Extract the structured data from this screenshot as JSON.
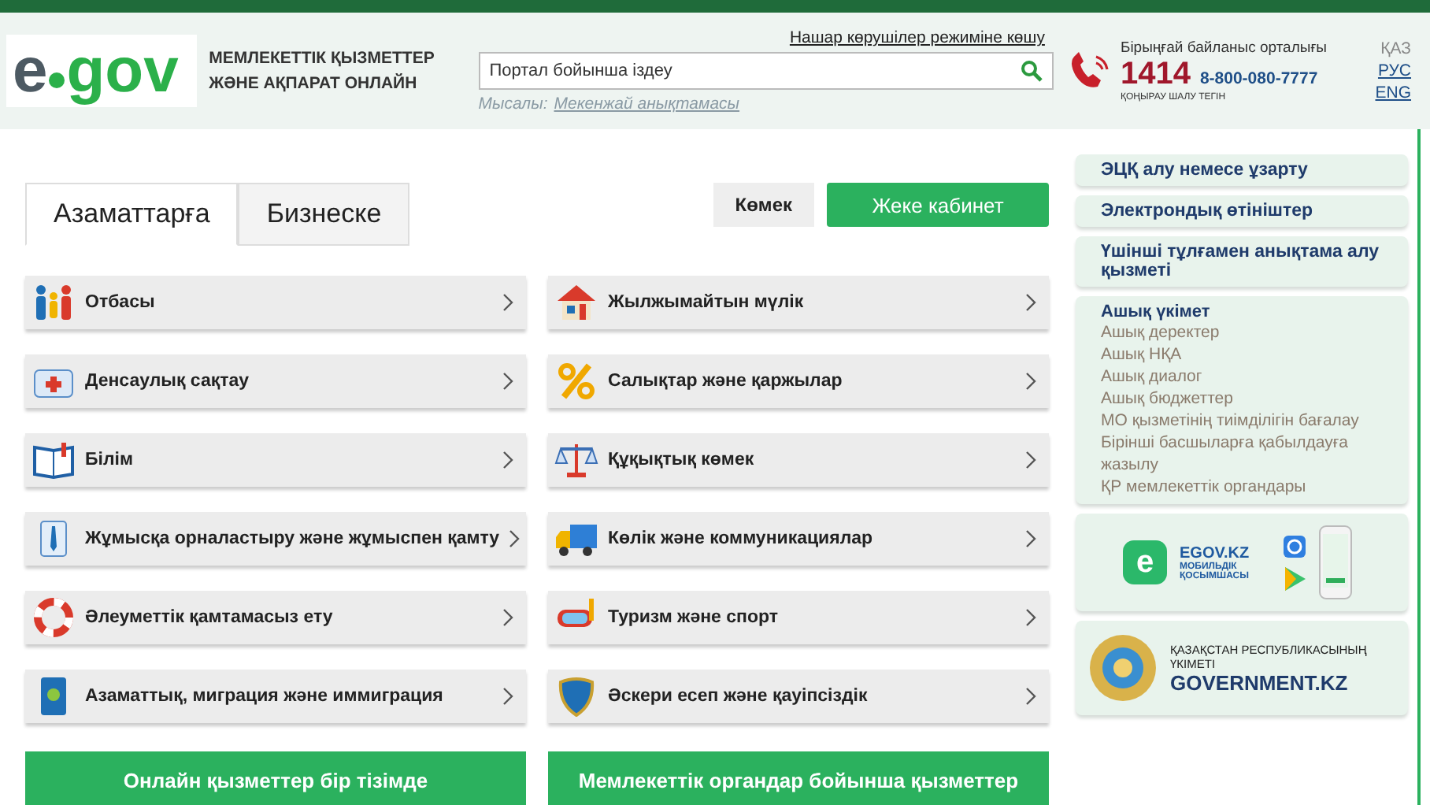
{
  "header": {
    "logo": {
      "prefix": "e",
      "word": "gov"
    },
    "tagline": [
      "МЕМЛЕКЕТТІК ҚЫЗМЕТТЕР",
      "ЖӘНЕ АҚПАРАТ ОНЛАЙН"
    ],
    "accessibility_link": "Нашар көрушілер режиміне көшу",
    "search": {
      "placeholder": "Портал бойынша іздеу"
    },
    "example": {
      "label": "Мысалы:",
      "link": "Мекенжай анықтамасы"
    },
    "contact": {
      "title": "Бірыңғай байланыс орталығы",
      "short_number": "1414",
      "phone": "8-800-080-7777",
      "note": "ҚОҢЫРАУ ШАЛУ ТЕГІН"
    },
    "languages": [
      {
        "label": "ҚАЗ",
        "selected": true
      },
      {
        "label": "РУС",
        "selected": false
      },
      {
        "label": "ENG",
        "selected": false
      }
    ]
  },
  "tabs": [
    {
      "label": "Азаматтарға",
      "selected": true
    },
    {
      "label": "Бизнеске",
      "selected": false
    }
  ],
  "help_button": "Көмек",
  "cabinet_button": "Жеке кабинет",
  "categories_left": [
    {
      "label": "Отбасы",
      "kind": "family"
    },
    {
      "label": "Денсаулық сақтау",
      "kind": "health"
    },
    {
      "label": "Білім",
      "kind": "education"
    },
    {
      "label": "Жұмысқа орналастыру және жұмыспен қамту",
      "kind": "employment"
    },
    {
      "label": "Әлеуметтік қамтамасыз ету",
      "kind": "social"
    },
    {
      "label": "Азаматтық, миграция және иммиграция",
      "kind": "passport"
    }
  ],
  "categories_right": [
    {
      "label": "Жылжымайтын мүлік",
      "kind": "house"
    },
    {
      "label": "Салықтар және қаржылар",
      "kind": "percent"
    },
    {
      "label": "Құқықтық көмек",
      "kind": "scales"
    },
    {
      "label": "Көлік және коммуникациялар",
      "kind": "truck"
    },
    {
      "label": "Туризм және спорт",
      "kind": "mask"
    },
    {
      "label": "Әскери есеп және қауіпсіздік",
      "kind": "shield"
    }
  ],
  "bottom_buttons": [
    "Онлайн қызметтер бір тізімде",
    "Мемлекеттік органдар бойынша қызметтер"
  ],
  "sidebar": {
    "links": [
      {
        "label": "ЭЦҚ алу немесе ұзарту"
      },
      {
        "label": "Электрондық өтініштер"
      },
      {
        "label": "Үшінші тұлғамен анықтама алу қызметі"
      }
    ],
    "open_government": {
      "title": "Ашық үкімет",
      "items": [
        "Ашық деректер",
        "Ашық НҚА",
        "Ашық диалог",
        "Ашық бюджеттер",
        "МО қызметінің тиімділігін бағалау",
        "Бірінші басшыларға қабылдауға жазылу",
        "ҚР мемлекеттік органдары"
      ]
    },
    "mobile_app": {
      "title": "EGOV.KZ",
      "subtitle": [
        "МОБИЛЬДІК",
        "ҚОСЫМШАСЫ"
      ],
      "logo": "e"
    },
    "government": {
      "title": [
        "ҚАЗАҚСТАН РЕСПУБЛИКАСЫНЫҢ",
        "ҮКІМЕТІ"
      ],
      "site": "GOVERNMENT.KZ"
    }
  }
}
